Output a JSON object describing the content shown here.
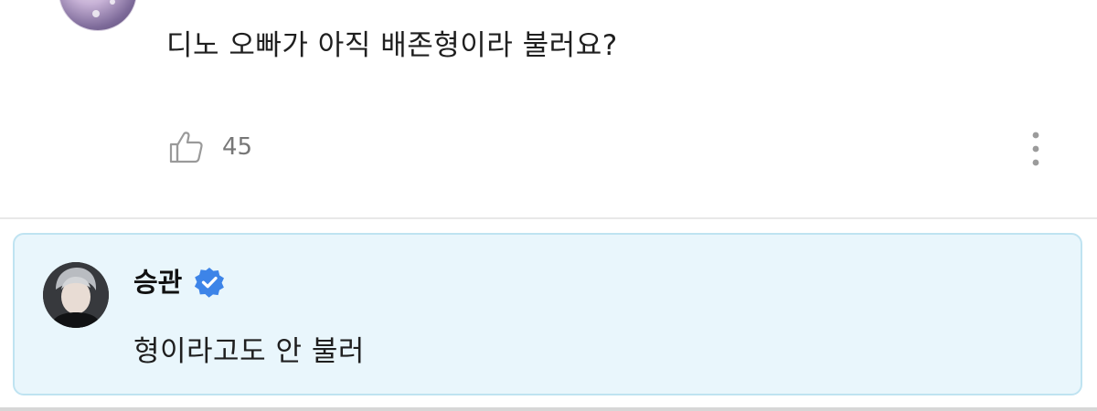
{
  "comment": {
    "text": "디노 오빠가 아직 배존형이라 불러요?",
    "like_count": "45",
    "icons": {
      "like": "thumbs-up-icon",
      "more": "more-vertical-icon"
    }
  },
  "reply": {
    "author": "승관",
    "text": "형이라고도 안 불러",
    "verified": true,
    "icons": {
      "verified": "verified-badge-icon"
    }
  },
  "colors": {
    "reply_background": "#e9f6fc",
    "reply_border": "#bfe3f1",
    "verified_badge": "#3d84e8",
    "muted_text": "#777777"
  }
}
